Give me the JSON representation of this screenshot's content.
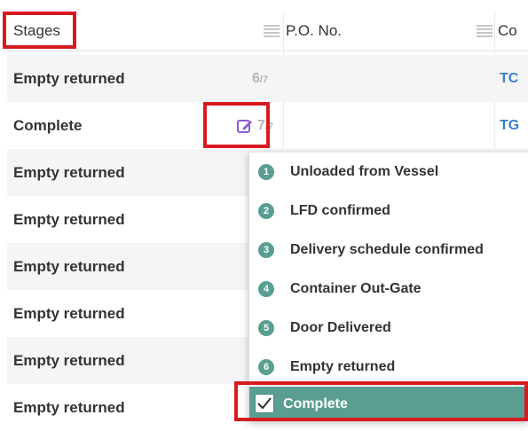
{
  "header": {
    "stages": "Stages",
    "po": "P.O. No.",
    "third": "Co"
  },
  "rows": [
    {
      "stage": "Empty returned",
      "count_num": "6",
      "count_den": "/7",
      "po": "TC"
    },
    {
      "stage": "Complete",
      "count_num": "7",
      "count_den": "/7",
      "po": "TG"
    },
    {
      "stage": "Empty returned"
    },
    {
      "stage": "Empty returned"
    },
    {
      "stage": "Empty returned"
    },
    {
      "stage": "Empty returned"
    },
    {
      "stage": "Empty returned"
    },
    {
      "stage": "Empty returned"
    }
  ],
  "dropdown": {
    "items": [
      {
        "num": "1",
        "label": "Unloaded from Vessel"
      },
      {
        "num": "2",
        "label": "LFD confirmed"
      },
      {
        "num": "3",
        "label": "Delivery schedule confirmed"
      },
      {
        "num": "4",
        "label": "Container Out-Gate"
      },
      {
        "num": "5",
        "label": "Door Delivered"
      },
      {
        "num": "6",
        "label": "Empty returned"
      }
    ],
    "selected": "Complete"
  },
  "colors": {
    "accent": "#5a9e92",
    "highlight": "#d71920",
    "link": "#3a7ecf"
  },
  "icons": [
    "menu-icon",
    "edit-icon",
    "checkmark-icon"
  ]
}
